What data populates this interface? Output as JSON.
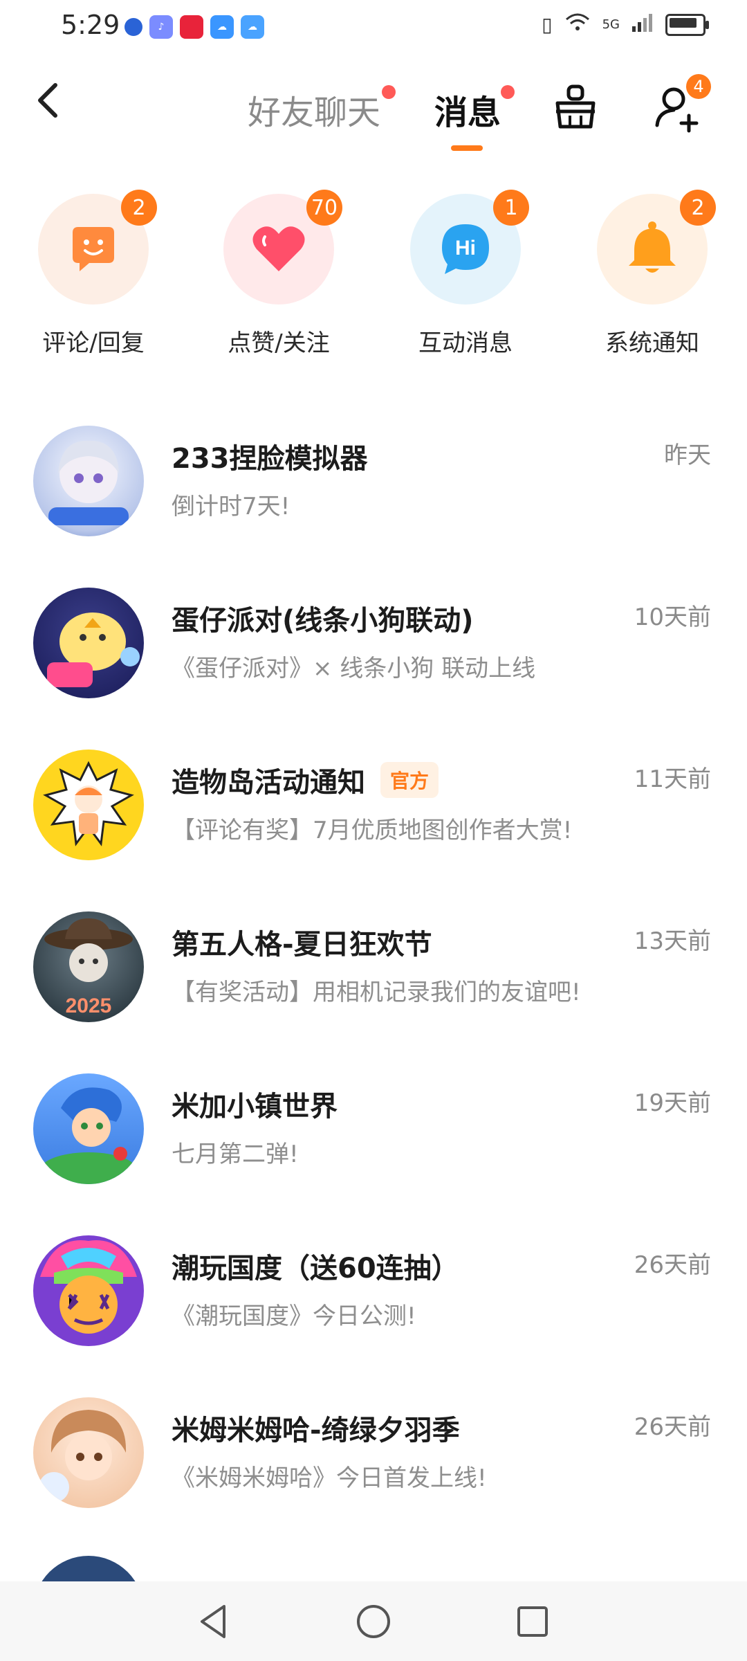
{
  "status_bar": {
    "time": "5:29",
    "left_icons": [
      "notification-dot-icon",
      "music-app-icon",
      "xiaohongshu-icon",
      "weather-icon",
      "cloud-icon"
    ],
    "network": "5G",
    "battery_level": 0.85
  },
  "header": {
    "tabs": [
      {
        "label": "好友聊天",
        "has_dot": true
      },
      {
        "label": "消息",
        "has_dot": true,
        "active": true
      }
    ],
    "add_friend_badge": "4"
  },
  "categories": [
    {
      "label": "评论/回复",
      "badge": "2",
      "icon": "comment-face-icon",
      "bg": "#fdeee5",
      "color": "#ff8a3d"
    },
    {
      "label": "点赞/关注",
      "badge": "70",
      "icon": "heart-icon",
      "bg": "#ffe9ea",
      "color": "#ff4f6a"
    },
    {
      "label": "互动消息",
      "badge": "1",
      "icon": "hi-bubble-icon",
      "bg": "#e4f3fb",
      "color": "#2aa3f0"
    },
    {
      "label": "系统通知",
      "badge": "2",
      "icon": "bell-icon",
      "bg": "#fff1e3",
      "color": "#ff9f1c"
    }
  ],
  "messages": [
    {
      "title": "233捏脸模拟器",
      "subtitle": "倒计时7天!",
      "time": "昨天",
      "official": false
    },
    {
      "title": "蛋仔派对(线条小狗联动)",
      "subtitle": "《蛋仔派对》× 线条小狗 联动上线",
      "time": "10天前",
      "official": false
    },
    {
      "title": "造物岛活动通知",
      "subtitle": "【评论有奖】7月优质地图创作者大赏!",
      "time": "11天前",
      "official": true,
      "official_label": "官方"
    },
    {
      "title": "第五人格-夏日狂欢节",
      "subtitle": "【有奖活动】用相机记录我们的友谊吧!",
      "time": "13天前",
      "official": false
    },
    {
      "title": "米加小镇世界",
      "subtitle": "七月第二弹!",
      "time": "19天前",
      "official": false
    },
    {
      "title": "潮玩国度（送60连抽）",
      "subtitle": "《潮玩国度》今日公测!",
      "time": "26天前",
      "official": false
    },
    {
      "title": "米姆米姆哈-绮绿夕羽季",
      "subtitle": "《米姆米姆哈》今日首发上线!",
      "time": "26天前",
      "official": false
    }
  ]
}
